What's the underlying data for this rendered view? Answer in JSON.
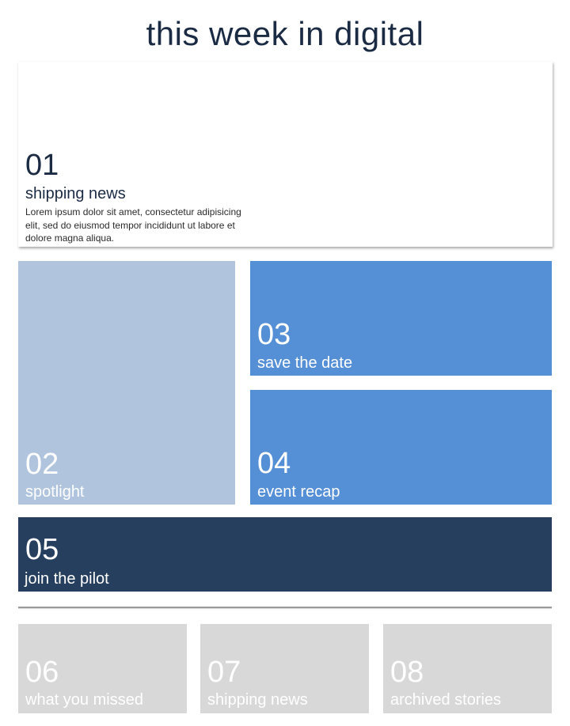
{
  "header": {
    "title": "this week in digital"
  },
  "tiles": [
    {
      "number": "01",
      "label": "shipping news",
      "description": "Lorem ipsum dolor sit amet, consectetur adipisicing elit, sed do eiusmod tempor incididunt ut labore et dolore magna aliqua.",
      "color": "#ffffff"
    },
    {
      "number": "02",
      "label": "spotlight",
      "color": "#b0c4de"
    },
    {
      "number": "03",
      "label": "save the date",
      "color": "#558fd6"
    },
    {
      "number": "04",
      "label": "event recap",
      "color": "#558fd6"
    },
    {
      "number": "05",
      "label": "join the pilot",
      "color": "#263f5f"
    }
  ],
  "archive": [
    {
      "number": "06",
      "label": "what you missed",
      "color": "#d8d8d8"
    },
    {
      "number": "07",
      "label": "shipping news",
      "color": "#d8d8d8"
    },
    {
      "number": "08",
      "label": "archived stories",
      "color": "#d8d8d8"
    }
  ]
}
